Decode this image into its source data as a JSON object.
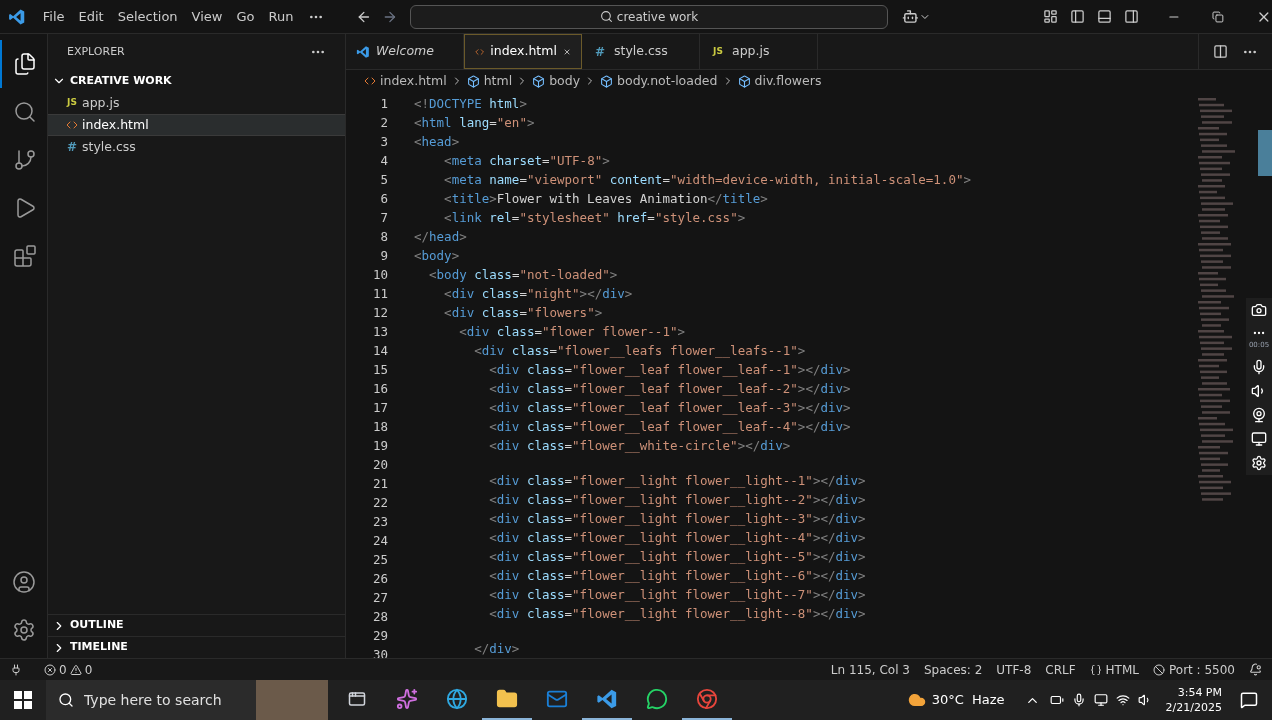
{
  "menu": [
    "File",
    "Edit",
    "Selection",
    "View",
    "Go",
    "Run"
  ],
  "command_center": {
    "value": "creative work"
  },
  "activity_bar": [
    {
      "kind": "files",
      "selected": true
    },
    {
      "kind": "search",
      "selected": false
    },
    {
      "kind": "source-control",
      "selected": false
    },
    {
      "kind": "run",
      "selected": false
    },
    {
      "kind": "extensions",
      "selected": false
    }
  ],
  "sidebar": {
    "title": "EXPLORER",
    "folder": {
      "name": "CREATIVE WORK",
      "expanded": true,
      "files": [
        {
          "name": "app.js",
          "kind": "js",
          "glyph": "JS",
          "selected": false
        },
        {
          "name": "index.html",
          "kind": "html",
          "selected": true
        },
        {
          "name": "style.css",
          "kind": "css",
          "glyph": "#",
          "selected": false
        }
      ]
    },
    "sections": [
      {
        "name": "OUTLINE",
        "expanded": false
      },
      {
        "name": "TIMELINE",
        "expanded": false
      }
    ]
  },
  "tabs": [
    {
      "label": "Welcome",
      "kind": "welcome",
      "selected": false
    },
    {
      "label": "index.html",
      "kind": "html",
      "selected": true
    },
    {
      "label": "style.css",
      "kind": "css",
      "glyph": "#",
      "selected": false
    },
    {
      "label": "app.js",
      "kind": "js",
      "glyph": "JS",
      "selected": false
    }
  ],
  "breadcrumbs": [
    {
      "label": "index.html",
      "kind": "html"
    },
    {
      "label": "html",
      "kind": "element"
    },
    {
      "label": "body",
      "kind": "element"
    },
    {
      "label": "body.not-loaded",
      "kind": "element"
    },
    {
      "label": "div.flowers",
      "kind": "element"
    }
  ],
  "code_lines": [
    {
      "number": "1",
      "code": "<!DOCTYPE html>"
    },
    {
      "number": "2",
      "code": "<html lang=\"en\">"
    },
    {
      "number": "3",
      "code": "<head>"
    },
    {
      "number": "4",
      "code": "    <meta charset=\"UTF-8\">"
    },
    {
      "number": "5",
      "code": "    <meta name=\"viewport\" content=\"width=device-width, initial-scale=1.0\">"
    },
    {
      "number": "6",
      "code": "    <title>Flower with Leaves Animation</title>"
    },
    {
      "number": "7",
      "code": "    <link rel=\"stylesheet\" href=\"style.css\">"
    },
    {
      "number": "8",
      "code": "</head>"
    },
    {
      "number": "9",
      "code": "<body>"
    },
    {
      "number": "10",
      "code": "  <body class=\"not-loaded\">"
    },
    {
      "number": "11",
      "code": "    <div class=\"night\"></div>"
    },
    {
      "number": "12",
      "code": "    <div class=\"flowers\">"
    },
    {
      "number": "13",
      "code": "      <div class=\"flower flower--1\">"
    },
    {
      "number": "14",
      "code": "        <div class=\"flower__leafs flower__leafs--1\">"
    },
    {
      "number": "15",
      "code": "          <div class=\"flower__leaf flower__leaf--1\"></div>"
    },
    {
      "number": "16",
      "code": "          <div class=\"flower__leaf flower__leaf--2\"></div>"
    },
    {
      "number": "17",
      "code": "          <div class=\"flower__leaf flower__leaf--3\"></div>"
    },
    {
      "number": "18",
      "code": "          <div class=\"flower__leaf flower__leaf--4\"></div>"
    },
    {
      "number": "19",
      "code": "          <div class=\"flower__white-circle\"></div>"
    },
    {
      "number": "20"
    },
    {
      "number": "21",
      "code": "          <div class=\"flower__light flower__light--1\"></div>"
    },
    {
      "number": "22",
      "code": "          <div class=\"flower__light flower__light--2\"></div>"
    },
    {
      "number": "23",
      "code": "          <div class=\"flower__light flower__light--3\"></div>"
    },
    {
      "number": "24",
      "code": "          <div class=\"flower__light flower__light--4\"></div>"
    },
    {
      "number": "25",
      "code": "          <div class=\"flower__light flower__light--5\"></div>"
    },
    {
      "number": "26",
      "code": "          <div class=\"flower__light flower__light--6\"></div>"
    },
    {
      "number": "27",
      "code": "          <div class=\"flower__light flower__light--7\"></div>"
    },
    {
      "number": "28",
      "code": "          <div class=\"flower__light flower__light--8\"></div>"
    },
    {
      "number": "29"
    },
    {
      "number": "30",
      "code": "        </div>"
    }
  ],
  "recorder": {
    "timer": "00:05"
  },
  "status_bar": {
    "errors": "0",
    "warnings": "0",
    "position": "Ln 115, Col 3",
    "spaces": "Spaces: 2",
    "encoding": "UTF-8",
    "eol": "CRLF",
    "language": "HTML",
    "port": "Port : 5500"
  },
  "taskbar": {
    "search": {
      "placeholder": "Type here to search"
    },
    "apps": [
      {
        "kind": "task-view",
        "selected": false
      },
      {
        "kind": "copilot",
        "selected": false
      },
      {
        "kind": "edge",
        "selected": false
      },
      {
        "kind": "folder",
        "selected": true
      },
      {
        "kind": "outlook",
        "selected": false
      },
      {
        "kind": "vscode",
        "selected": true
      },
      {
        "kind": "whatsapp",
        "selected": false
      },
      {
        "kind": "chrome",
        "selected": true
      }
    ],
    "weather": "30°C  Haze",
    "time": "3:54 PM",
    "date": "2/21/2025"
  }
}
